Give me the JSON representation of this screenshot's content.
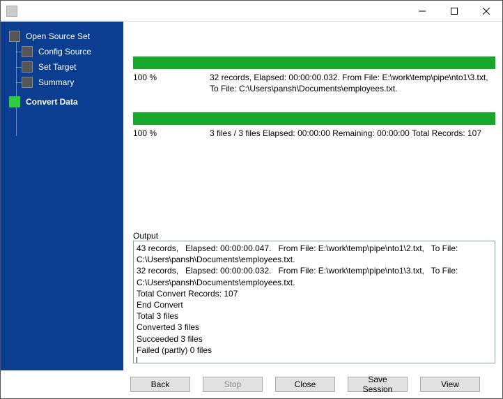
{
  "window": {
    "title": ""
  },
  "sidebar": {
    "items": [
      {
        "label": "Open Source Set",
        "active": false,
        "child": false
      },
      {
        "label": "Config Source",
        "active": false,
        "child": true
      },
      {
        "label": "Set Target",
        "active": false,
        "child": true
      },
      {
        "label": "Summary",
        "active": false,
        "child": true
      },
      {
        "label": "Convert Data",
        "active": true,
        "child": false
      }
    ]
  },
  "progress_file": {
    "percent": "100 %",
    "info": "32 records,   Elapsed: 00:00:00.032.   From File: E:\\work\\temp\\pipe\\nto1\\3.txt,   To File: C:\\Users\\pansh\\Documents\\employees.txt."
  },
  "progress_total": {
    "percent": "100 %",
    "info": "3 files / 3 files   Elapsed: 00:00:00   Remaining: 00:00:00   Total Records: 107"
  },
  "output": {
    "label": "Output",
    "text": "43 records,   Elapsed: 00:00:00.047.   From File: E:\\work\\temp\\pipe\\nto1\\2.txt,   To File: C:\\Users\\pansh\\Documents\\employees.txt.\n32 records,   Elapsed: 00:00:00.032.   From File: E:\\work\\temp\\pipe\\nto1\\3.txt,   To File: C:\\Users\\pansh\\Documents\\employees.txt.\nTotal Convert Records: 107\nEnd Convert\nTotal 3 files\nConverted 3 files\nSucceeded 3 files\nFailed (partly) 0 files"
  },
  "buttons": {
    "back": "Back",
    "stop": "Stop",
    "close": "Close",
    "save_session": "Save Session",
    "view": "View"
  }
}
